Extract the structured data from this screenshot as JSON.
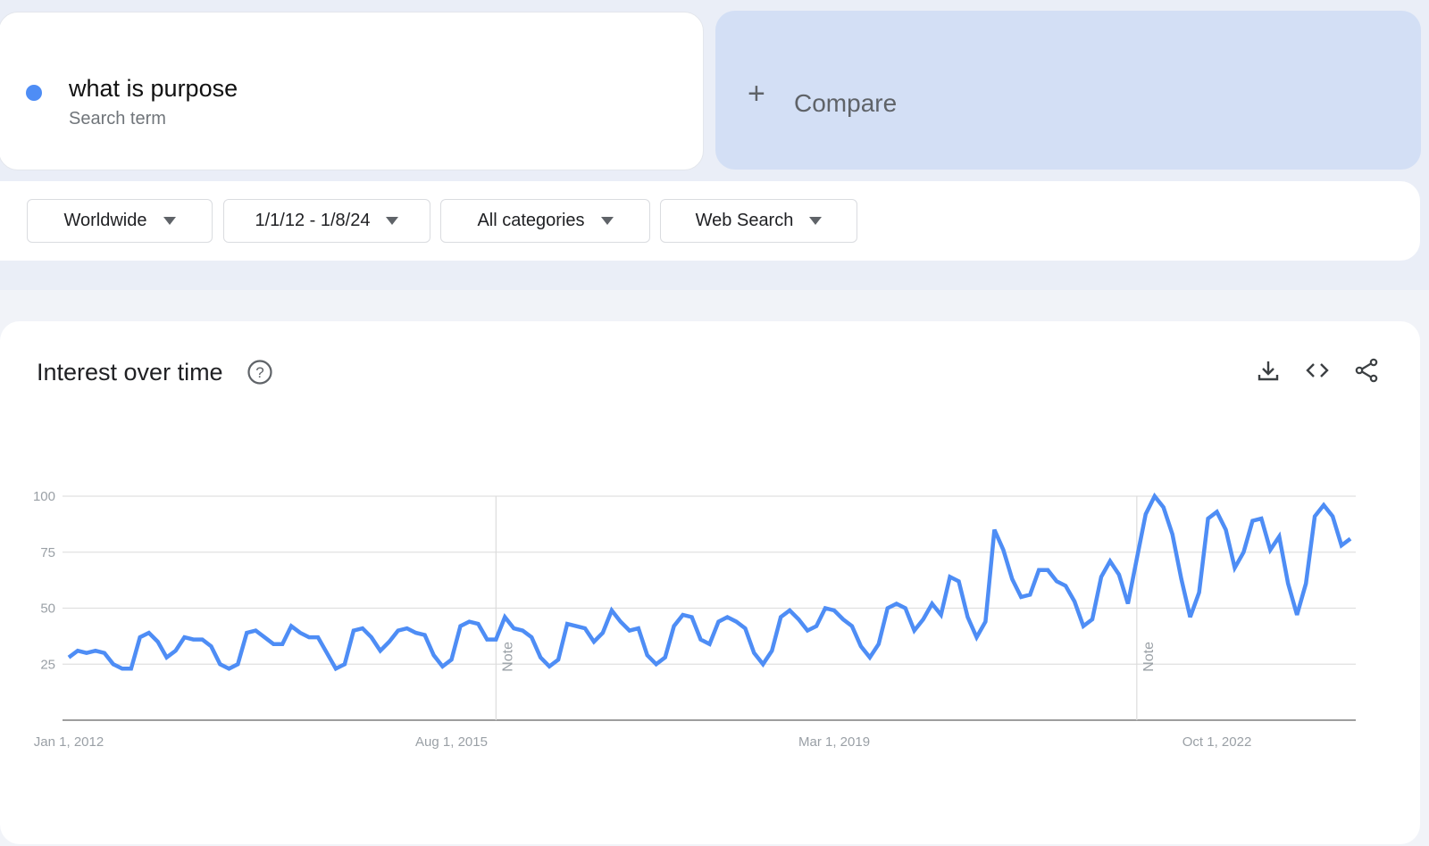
{
  "search_term": {
    "name": "what is purpose",
    "type": "Search term",
    "color": "#4e8df5"
  },
  "compare": {
    "label": "Compare",
    "icon": "plus-icon"
  },
  "filters": [
    {
      "label": "Worldwide"
    },
    {
      "label": "1/1/12 - 1/8/24"
    },
    {
      "label": "All categories"
    },
    {
      "label": "Web Search"
    }
  ],
  "interest_panel": {
    "title": "Interest over time",
    "help_icon": "help-circle-icon",
    "actions": [
      "download-icon",
      "embed-code-icon",
      "share-icon"
    ]
  },
  "chart_data": {
    "type": "line",
    "title": "Interest over time",
    "xlabel": "",
    "ylabel": "",
    "ylim": [
      0,
      100
    ],
    "yticks": [
      25,
      50,
      75,
      100
    ],
    "xtick_labels": [
      "Jan 1, 2012",
      "Aug 1, 2015",
      "Mar 1, 2019",
      "Oct 1, 2022"
    ],
    "xtick_month_index": [
      0,
      43,
      86,
      129
    ],
    "x_start": "2012-01",
    "x_step": "month",
    "grid": true,
    "notes": [
      {
        "label": "Note",
        "month_index": 48
      },
      {
        "label": "Note",
        "month_index": 120
      }
    ],
    "series": [
      {
        "name": "what is purpose",
        "color": "#4e8df5",
        "values": [
          28,
          31,
          30,
          31,
          30,
          25,
          23,
          23,
          37,
          39,
          35,
          28,
          31,
          37,
          36,
          36,
          33,
          25,
          23,
          25,
          39,
          40,
          37,
          34,
          34,
          42,
          39,
          37,
          37,
          30,
          23,
          25,
          40,
          41,
          37,
          31,
          35,
          40,
          41,
          39,
          38,
          29,
          24,
          27,
          42,
          44,
          43,
          36,
          36,
          46,
          41,
          40,
          37,
          28,
          24,
          27,
          43,
          42,
          41,
          35,
          39,
          49,
          44,
          40,
          41,
          29,
          25,
          28,
          42,
          47,
          46,
          36,
          34,
          44,
          46,
          44,
          41,
          30,
          25,
          31,
          46,
          49,
          45,
          40,
          42,
          50,
          49,
          45,
          42,
          33,
          28,
          34,
          50,
          52,
          50,
          40,
          45,
          52,
          47,
          64,
          62,
          46,
          37,
          44,
          85,
          76,
          63,
          55,
          56,
          67,
          67,
          62,
          60,
          53,
          42,
          45,
          64,
          71,
          65,
          52,
          72,
          92,
          100,
          95,
          83,
          63,
          46,
          57,
          90,
          93,
          85,
          68,
          75,
          89,
          90,
          76,
          82,
          61,
          47,
          61,
          91,
          96,
          91,
          78,
          81
        ]
      }
    ]
  }
}
